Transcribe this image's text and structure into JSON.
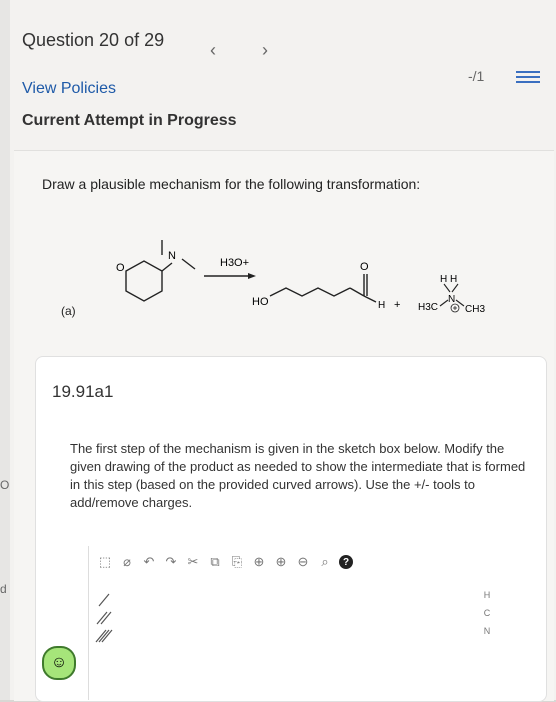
{
  "header": {
    "question_counter": "Question 20 of 29",
    "prev_icon": "chevron-left",
    "next_icon": "chevron-right",
    "score": "-/1",
    "view_policies": "View Policies",
    "attempt_status": "Current Attempt in Progress"
  },
  "question": {
    "prompt": "Draw a plausible mechanism for the following transformation:",
    "part_label": "(a)",
    "reagent": "H3O+",
    "product_ho": "HO",
    "product_h": "H",
    "plus": "+",
    "amine_hh": "H H",
    "amine_n": "N",
    "amine_left": "H3C",
    "amine_right": "CH3",
    "ring_o": "O",
    "ring_n": "N",
    "carbonyl_o": "O"
  },
  "subpart": {
    "id": "19.91a1",
    "description": "The first step of the mechanism is given in the sketch box below. Modify the given drawing of the product as needed to show the intermediate that is formed in this step (based on the provided curved arrows). Use the +/- tools to add/remove charges."
  },
  "toolbar": {
    "items": [
      "select-icon",
      "erase-icon",
      "undo-icon",
      "redo-icon",
      "cut-icon",
      "copy-icon",
      "paste-icon",
      "zoom-fit-icon",
      "zoom-in-icon",
      "zoom-out-icon",
      "search-icon",
      "help-icon"
    ]
  },
  "right_tools": {
    "items": [
      "H",
      "C",
      "N"
    ]
  },
  "left_edge": {
    "text1": "OR",
    "text2": "d"
  }
}
